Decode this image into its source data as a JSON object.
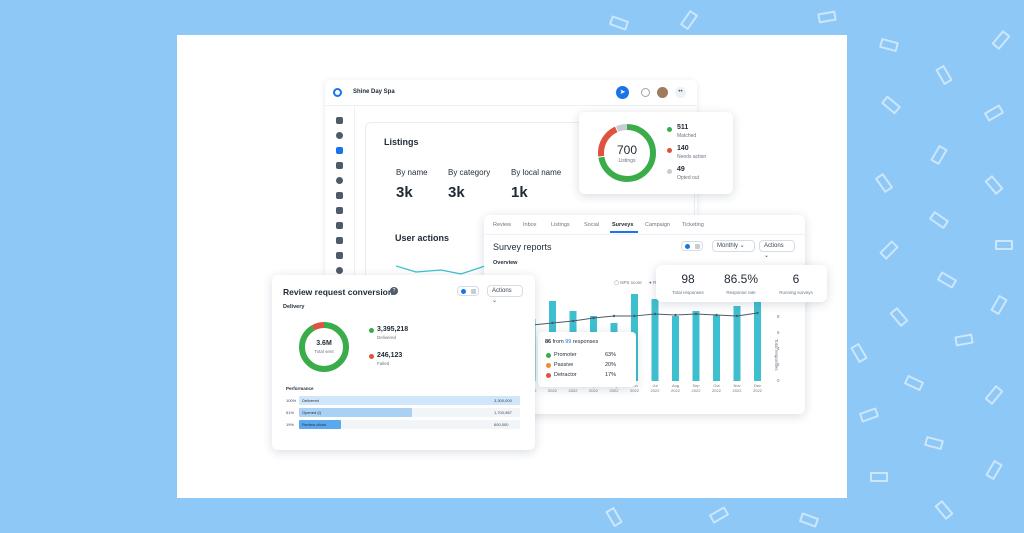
{
  "colors": {
    "background": "#8ec8f6",
    "accent": "#1a73e8",
    "green": "#3aad4a",
    "red": "#e05240",
    "orange": "#f08a2c",
    "teal": "#3ebfd0"
  },
  "app": {
    "name": "Shine Day Spa"
  },
  "listings": {
    "title": "Listings",
    "metrics": [
      {
        "label": "By name",
        "value": "3k"
      },
      {
        "label": "By category",
        "value": "3k"
      },
      {
        "label": "By local name",
        "value": "1k"
      }
    ],
    "user_actions_title": "User actions"
  },
  "ring_card": {
    "total": "700",
    "total_label": "Listings",
    "items": [
      {
        "value": "511",
        "label": "Matched",
        "color": "#3aad4a"
      },
      {
        "value": "140",
        "label": "Needs action",
        "color": "#e05240"
      },
      {
        "value": "49",
        "label": "Opted out",
        "color": "#c7ccd2"
      }
    ]
  },
  "survey": {
    "tabs": [
      "Review",
      "Inbox",
      "Listings",
      "Social",
      "Surveys",
      "Campaign",
      "Ticketing"
    ],
    "active_tab": "Surveys",
    "title": "Survey reports",
    "period": "Monthly",
    "actions": "Actions",
    "overview": "Overview",
    "legend": [
      "NPS score",
      "R"
    ],
    "tooltip": {
      "count": "86",
      "from_text": "from",
      "total": "99",
      "suffix": "responses",
      "rows": [
        {
          "label": "Promoter",
          "pct": "63%",
          "color": "#3aad4a"
        },
        {
          "label": "Passive",
          "pct": "20%",
          "color": "#f08a2c"
        },
        {
          "label": "Detractor",
          "pct": "17%",
          "color": "#e05240"
        }
      ]
    },
    "y_axis_label": "Total responses",
    "y_ticks": [
      "8",
      "6",
      "4",
      "2",
      "0"
    ]
  },
  "stats": [
    {
      "value": "98",
      "label": "Total responses"
    },
    {
      "value": "86.5%",
      "label": "Response rate"
    },
    {
      "value": "6",
      "label": "Running surveys"
    }
  ],
  "review": {
    "title": "Review request conversion",
    "section": "Delivery",
    "actions": "Actions",
    "donut_value": "3.6M",
    "donut_label": "Total sent",
    "items": [
      {
        "value": "3,395,218",
        "label": "Delivered",
        "color": "#3aad4a"
      },
      {
        "value": "246,123",
        "label": "Failed",
        "color": "#e05240"
      }
    ],
    "performance_title": "Performance",
    "performance": [
      {
        "pct": "100%",
        "label": "Delivered",
        "value": "3,300,000",
        "fill": 1.0
      },
      {
        "pct": "51%",
        "label": "Opened (i)",
        "value": "1,700,987",
        "fill": 0.51
      },
      {
        "pct": "19%",
        "label": "Review clicks",
        "value": "600,000",
        "fill": 0.19
      }
    ]
  },
  "chart_data": {
    "type": "bar",
    "categories": [
      "Jan 2022",
      "Feb 2022",
      "Mar 2022",
      "Apr 2022",
      "May 2022",
      "Jun 2022",
      "Jul 2022",
      "Aug 2022",
      "Sep 2022",
      "Oct 2022",
      "Nov 2022",
      "Dec 2022"
    ],
    "series": [
      {
        "name": "NPS score",
        "type": "line",
        "values": [
          5.6,
          5.8,
          6.0,
          6.3,
          6.5,
          6.5,
          6.7,
          6.6,
          6.7,
          6.6,
          6.5,
          6.8
        ]
      },
      {
        "name": "R",
        "type": "bar",
        "values": [
          6.2,
          8.0,
          7.0,
          6.5,
          5.8,
          8.7,
          8.2,
          6.5,
          7.0,
          6.6,
          7.5,
          9.5
        ]
      }
    ],
    "ylabel": "Total responses",
    "ylim": [
      0,
      8
    ]
  }
}
